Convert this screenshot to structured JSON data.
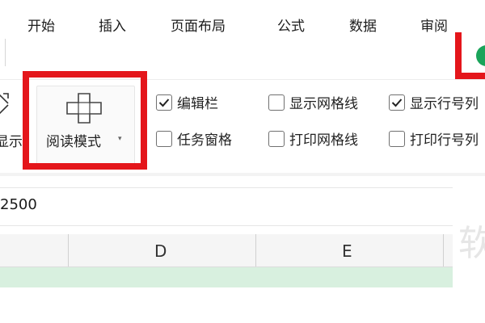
{
  "menu": {
    "tabs": [
      "开始",
      "插入",
      "页面布局",
      "公式",
      "数据",
      "审阅"
    ]
  },
  "ribbon": {
    "cut_off_label": "显示",
    "reading_mode": {
      "label": "阅读模式",
      "caret": "▾",
      "icon": "reading-mode-cross-icon"
    },
    "checkboxes": [
      {
        "label": "编辑栏",
        "checked": true
      },
      {
        "label": "显示网格线",
        "checked": false
      },
      {
        "label": "显示行号列",
        "checked": true
      },
      {
        "label": "任务窗格",
        "checked": false
      },
      {
        "label": "打印网格线",
        "checked": false
      },
      {
        "label": "打印行号列",
        "checked": false
      }
    ]
  },
  "formula_bar": {
    "value": "2500"
  },
  "grid": {
    "columns": [
      "D",
      "E"
    ]
  },
  "watermark": "软",
  "colors": {
    "highlight": "#e4161b",
    "accent_green": "#1aa45a",
    "row_highlight": "#d8f0df"
  }
}
